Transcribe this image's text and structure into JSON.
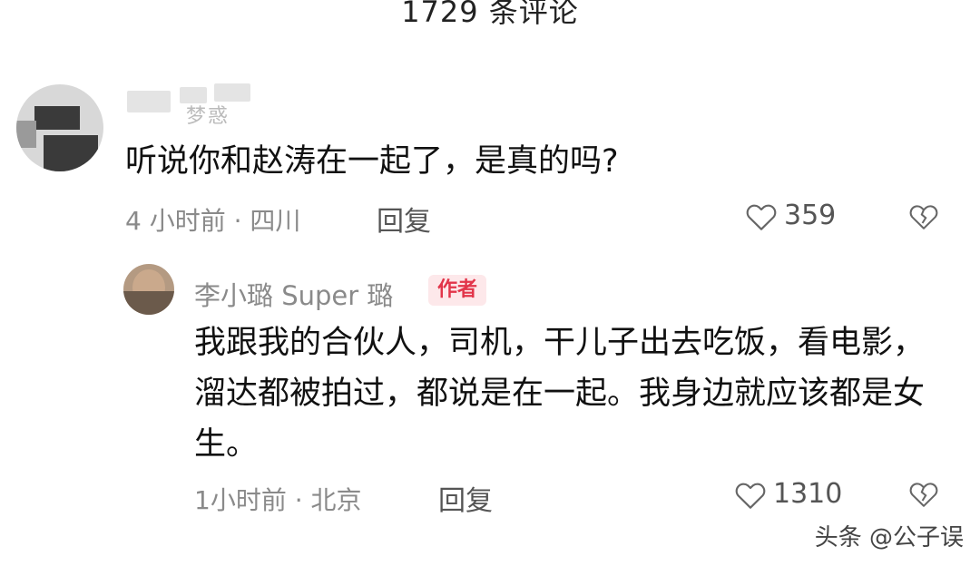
{
  "header": {
    "title": "1729 条评论"
  },
  "comments": [
    {
      "username_visible": "梦惑",
      "text": "听说你和赵涛在一起了，是真的吗?",
      "meta": "4 小时前 · 四川",
      "reply_label": "回复",
      "likes": "359"
    },
    {
      "username": "李小璐 Super 璐",
      "badge": "作者",
      "text": "我跟我的合伙人，司机，干儿子出去吃饭，看电影，溜达都被拍过，都说是在一起。我身边就应该都是女生。",
      "meta": "1小时前 · 北京",
      "reply_label": "回复",
      "likes": "1310"
    }
  ],
  "watermark": "头条 @公子误",
  "colors": {
    "badge_bg": "#fde8ea",
    "badge_fg": "#e2354a",
    "meta": "#8a8a8a"
  },
  "icons": {
    "like": "heart-outline-icon",
    "dislike": "broken-heart-icon"
  }
}
